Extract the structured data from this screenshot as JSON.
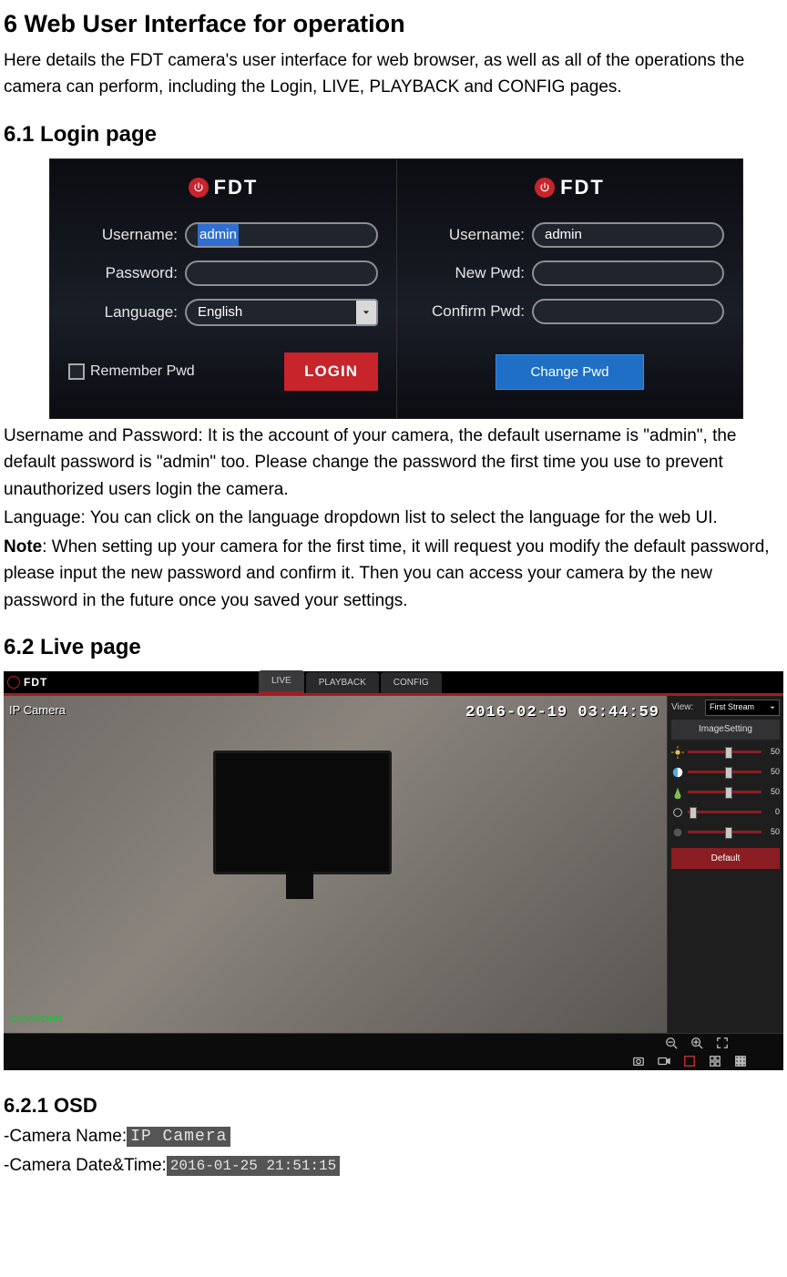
{
  "h1": "6 Web User Interface for operation",
  "intro": "Here details the FDT camera's user interface for web browser, as well as all of the operations the camera can perform, including the Login, LIVE, PLAYBACK and CONFIG pages.",
  "h2_login": "6.1 Login page",
  "login": {
    "brand": "FDT",
    "left": {
      "username_label": "Username:",
      "username_value": "admin",
      "password_label": "Password:",
      "password_value": "",
      "language_label": "Language:",
      "language_value": "English",
      "remember_label": "Remember Pwd",
      "login_label": "LOGIN"
    },
    "right": {
      "username_label": "Username:",
      "username_value": "admin",
      "newpwd_label": "New Pwd:",
      "newpwd_value": "",
      "confirm_label": "Confirm Pwd:",
      "confirm_value": "",
      "change_label": "Change Pwd"
    }
  },
  "login_para1": "Username and Password: It is the account of your camera, the default username is \"admin\", the default password is \"admin\" too. Please change the password the first time you use to prevent unauthorized users login the camera.",
  "login_para2": "Language: You can click on the language dropdown list to select the language for the web UI.",
  "note_label": "Note",
  "note_body": ": When setting up your camera for the first time, it will request you modify the default password, please input the new password and confirm it. Then you can access your camera by the new password in the future once you saved your settings.",
  "h2_live": "6.2 Live page",
  "live": {
    "brand": "FDT",
    "tabs": {
      "live": "LIVE",
      "playback": "PLAYBACK",
      "config": "CONFIG"
    },
    "osd_name": "IP Camera",
    "osd_time": "2016-02-19 03:44:59",
    "connected": "connected",
    "view_label": "View:",
    "view_value": "First Stream",
    "panel_header": "ImageSetting",
    "sliders": [
      {
        "name": "brightness",
        "value": 50
      },
      {
        "name": "contrast",
        "value": 50
      },
      {
        "name": "hue",
        "value": 50
      },
      {
        "name": "saturation",
        "value": 0
      },
      {
        "name": "sharpness",
        "value": 50
      }
    ],
    "default_label": "Default"
  },
  "h3_osd": "6.2.1 OSD",
  "osd_name_label": "-Camera Name:",
  "osd_name_chip": "IP Camera",
  "osd_time_label": "-Camera Date&Time:",
  "osd_time_chip": "2016-01-25 21:51:15"
}
